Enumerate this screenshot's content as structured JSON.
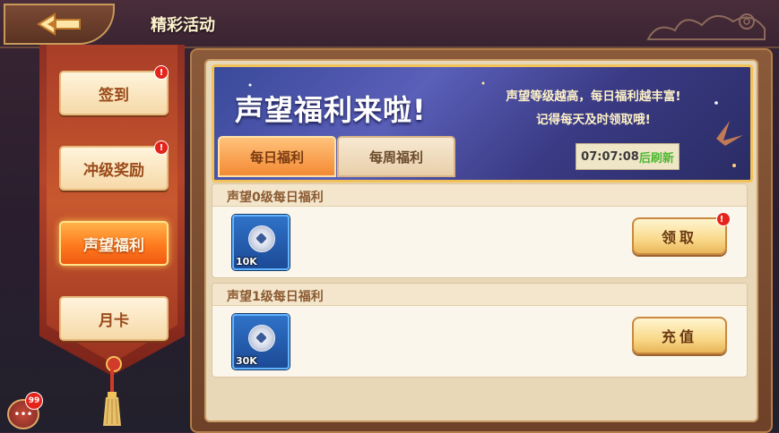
{
  "header": {
    "title": "精彩活动"
  },
  "sidebar": {
    "tabs": [
      {
        "label": "签到",
        "badge": "!"
      },
      {
        "label": "冲级奖励",
        "badge": "!"
      },
      {
        "label": "声望福利",
        "active": true
      },
      {
        "label": "月卡"
      }
    ]
  },
  "chat": {
    "count": "99"
  },
  "banner": {
    "title": "声望福利来啦!",
    "desc_line1": "声望等级越高，每日福利越丰富!",
    "desc_line2": "记得每天及时领取哦!",
    "tabs": [
      {
        "label": "每日福利",
        "active": true
      },
      {
        "label": "每周福利"
      }
    ],
    "timer": {
      "value": "07:07:08",
      "suffix": "后刷新"
    }
  },
  "rewards": [
    {
      "title": "声望0级每日福利",
      "item_qty": "10K",
      "item_icon": "silver-coin-icon",
      "button": "领取",
      "badge": "!"
    },
    {
      "title": "声望1级每日福利",
      "item_qty": "30K",
      "item_icon": "silver-coin-icon",
      "button": "充值"
    }
  ],
  "colors": {
    "accent": "#f48a34",
    "badge": "#e4241b",
    "timer_suffix": "#4db830"
  }
}
